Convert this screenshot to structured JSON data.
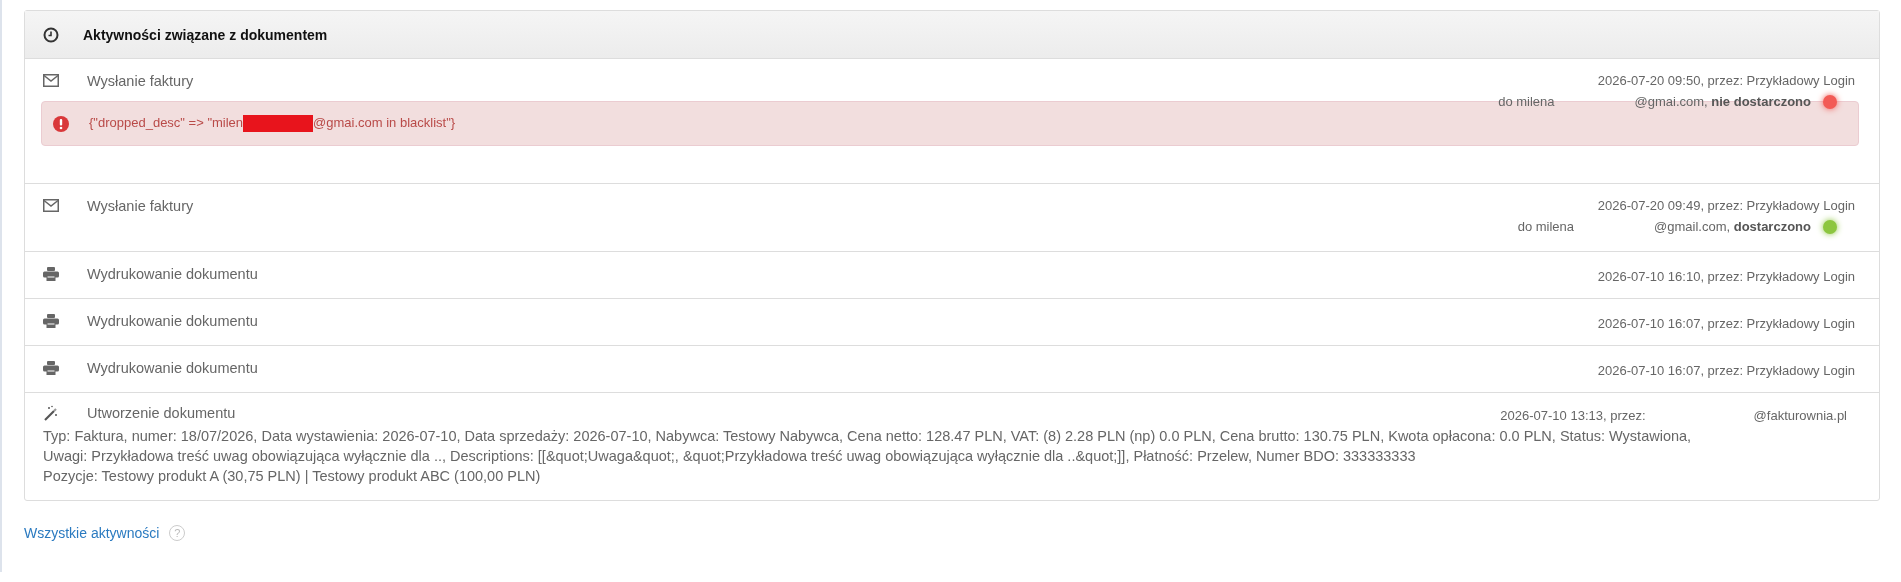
{
  "panel": {
    "title": "Aktywności związane z dokumentem"
  },
  "activities": [
    {
      "kind": "email",
      "title": "Wysłanie faktury",
      "meta": "2026-07-20 09:50, przez: Przykładowy Login",
      "recipient_start": "do milena",
      "recipient_end": "@gmai.com, **nie dostarczono**",
      "delivered": false,
      "alert": {
        "before": "{\"dropped_desc\" => \"milen",
        "after": "@gmai.com in blacklist\"}"
      }
    },
    {
      "kind": "email",
      "title": "Wysłanie faktury",
      "meta": "2026-07-20 09:49, przez: Przykładowy Login",
      "recipient_start": "do milena",
      "recipient_end": "@gmail.com, **dostarczono**",
      "delivered": true
    },
    {
      "kind": "print",
      "title": "Wydrukowanie dokumentu",
      "meta": "2026-07-10 16:10, przez: Przykładowy Login"
    },
    {
      "kind": "print",
      "title": "Wydrukowanie dokumentu",
      "meta": "2026-07-10 16:07, przez: Przykładowy Login"
    },
    {
      "kind": "print",
      "title": "Wydrukowanie dokumentu",
      "meta": "2026-07-10 16:07, przez: Przykładowy Login"
    },
    {
      "kind": "create",
      "title": "Utworzenie dokumentu",
      "meta_start": "2026-07-10 13:13, przez:",
      "meta_end": "@fakturownia.pl",
      "details": [
        "Typ: Faktura, numer: 18/07/2026, Data wystawienia: 2026-07-10, Data sprzedaży: 2026-07-10, Nabywca: Testowy Nabywca, Cena netto: 128.47 PLN, VAT: (8) 2.28 PLN (np) 0.0 PLN, Cena brutto: 130.75 PLN, Kwota opłacona: 0.0 PLN, Status: Wystawiona, Uwagi: Przykładowa treść uwag obowiązująca wyłącznie dla .., Descriptions: [[&quot;Uwaga&quot;, &quot;Przykładowa treść uwag obowiązująca wyłącznie dla ..&quot;]], Płatność: Przelew, Numer BDO: 333333333",
        "Pozycje: Testowy produkt A (30,75 PLN) | Testowy produkt ABC (100,00 PLN)"
      ]
    }
  ],
  "footer_link": "Wszystkie aktywności",
  "footer_help": "?"
}
